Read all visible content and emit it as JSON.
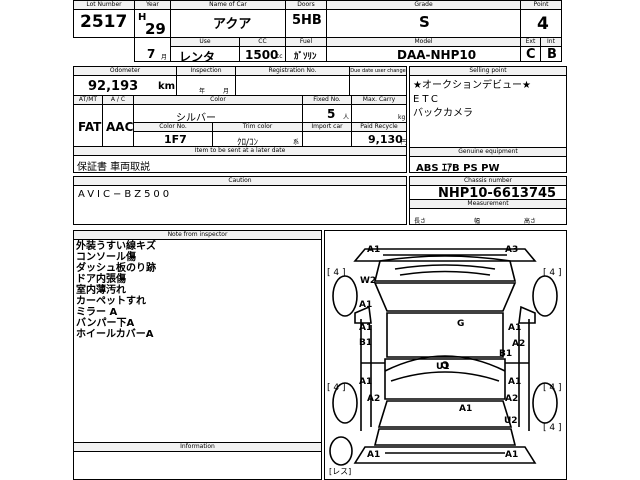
{
  "labels": {
    "lot_number": "Lot Number",
    "year": "Year",
    "name_of_car": "Name of Car",
    "doors": "Doors",
    "grade": "Grade",
    "point": "Point",
    "use": "Use",
    "cc": "CC",
    "fuel": "Fuel",
    "model": "Model",
    "ext": "Ext",
    "int": "Int",
    "odometer": "Odometer",
    "inspection": "Inspection",
    "registration_no": "Registration No.",
    "due_date": "Due date user change",
    "selling_point": "Selling point",
    "at_mt": "AT/MT",
    "ac": "A / C",
    "color": "Color",
    "fixed_no": "Fixed No.",
    "max_carry": "Max. Carry",
    "color_no": "Color No.",
    "trim_color": "Trim color",
    "import_car": "Import car",
    "paid_recycle": "Paid Recycle",
    "item_to_be_sent": "Item to be sent at a later date",
    "genuine_equipment": "Genuine equipment",
    "caution": "Caution",
    "chassis_number": "Chassis number",
    "measurement": "Measurement",
    "note_from_inspector": "Note from inspector",
    "information": "Information"
  },
  "units": {
    "year_char": "H",
    "month": "月",
    "cc": "cc",
    "km": "km",
    "inspection_year": "年",
    "inspection_month": "月",
    "persons": "人",
    "kg": "kg",
    "yen": "円",
    "ext_trim": "系",
    "length": "長さ",
    "width": "幅",
    "height": "高さ"
  },
  "values": {
    "lot_number": "2517",
    "year": "29",
    "name_of_car": "アクア",
    "doors": "5HB",
    "grade": "S",
    "point": "4",
    "month": "7",
    "use": "レンタ",
    "cc": "1500",
    "fuel": "ｶﾞｿﾘﾝ",
    "model": "DAA-NHP10",
    "ext": "C",
    "int": "B",
    "odometer": "92,193",
    "at_mt": "FAT",
    "ac": "AAC",
    "color": "シルバー",
    "fixed_no": "5",
    "color_no": "1F7",
    "trim_color": "ｸﾛ/ｺﾝ",
    "paid_recycle": "9,130",
    "item_to_be_sent": "保証書 車両取説",
    "genuine_equipment": "ABS ｴｱB PS PW",
    "caution": "AVIC−BZ500",
    "chassis_number": "NHP10-6613745"
  },
  "selling_points": [
    "★オークションデビュー★",
    "ETC",
    "バックカメラ"
  ],
  "inspector_notes": [
    "外装うすい線キズ",
    "コンソール傷",
    "ダッシュ板のり跡",
    "ドア内張傷",
    "室内薄汚れ",
    "カーペットすれ",
    "ミラー A",
    "バンパー下A",
    "ホイールカバーA"
  ],
  "diagram": {
    "tire_tags": [
      "[ 4 ]",
      "[ 4 ]",
      "[ 4 ]",
      "[ 4 ]",
      "[ 4 ]"
    ],
    "spare_tag": "[レス]",
    "damage_codes": {
      "front_left": "A1",
      "front_right": "A3",
      "windshield": "W2",
      "left_mirror": "A1",
      "left_front_door": "A1",
      "left_front_door_b": "B1",
      "roof": "G",
      "right_front_door": "A1",
      "right_front_door_b": "B1",
      "right_front_door_a2": "A2",
      "interior": "U1",
      "left_rear_door": "A1",
      "left_rear_quarter": "A2",
      "right_rear_door": "A1",
      "right_rear_quarter": "A2",
      "rear_hatch": "A1",
      "rear_glass": "U2",
      "rear_bumper_left": "A1",
      "rear_bumper_right": "A1"
    }
  }
}
